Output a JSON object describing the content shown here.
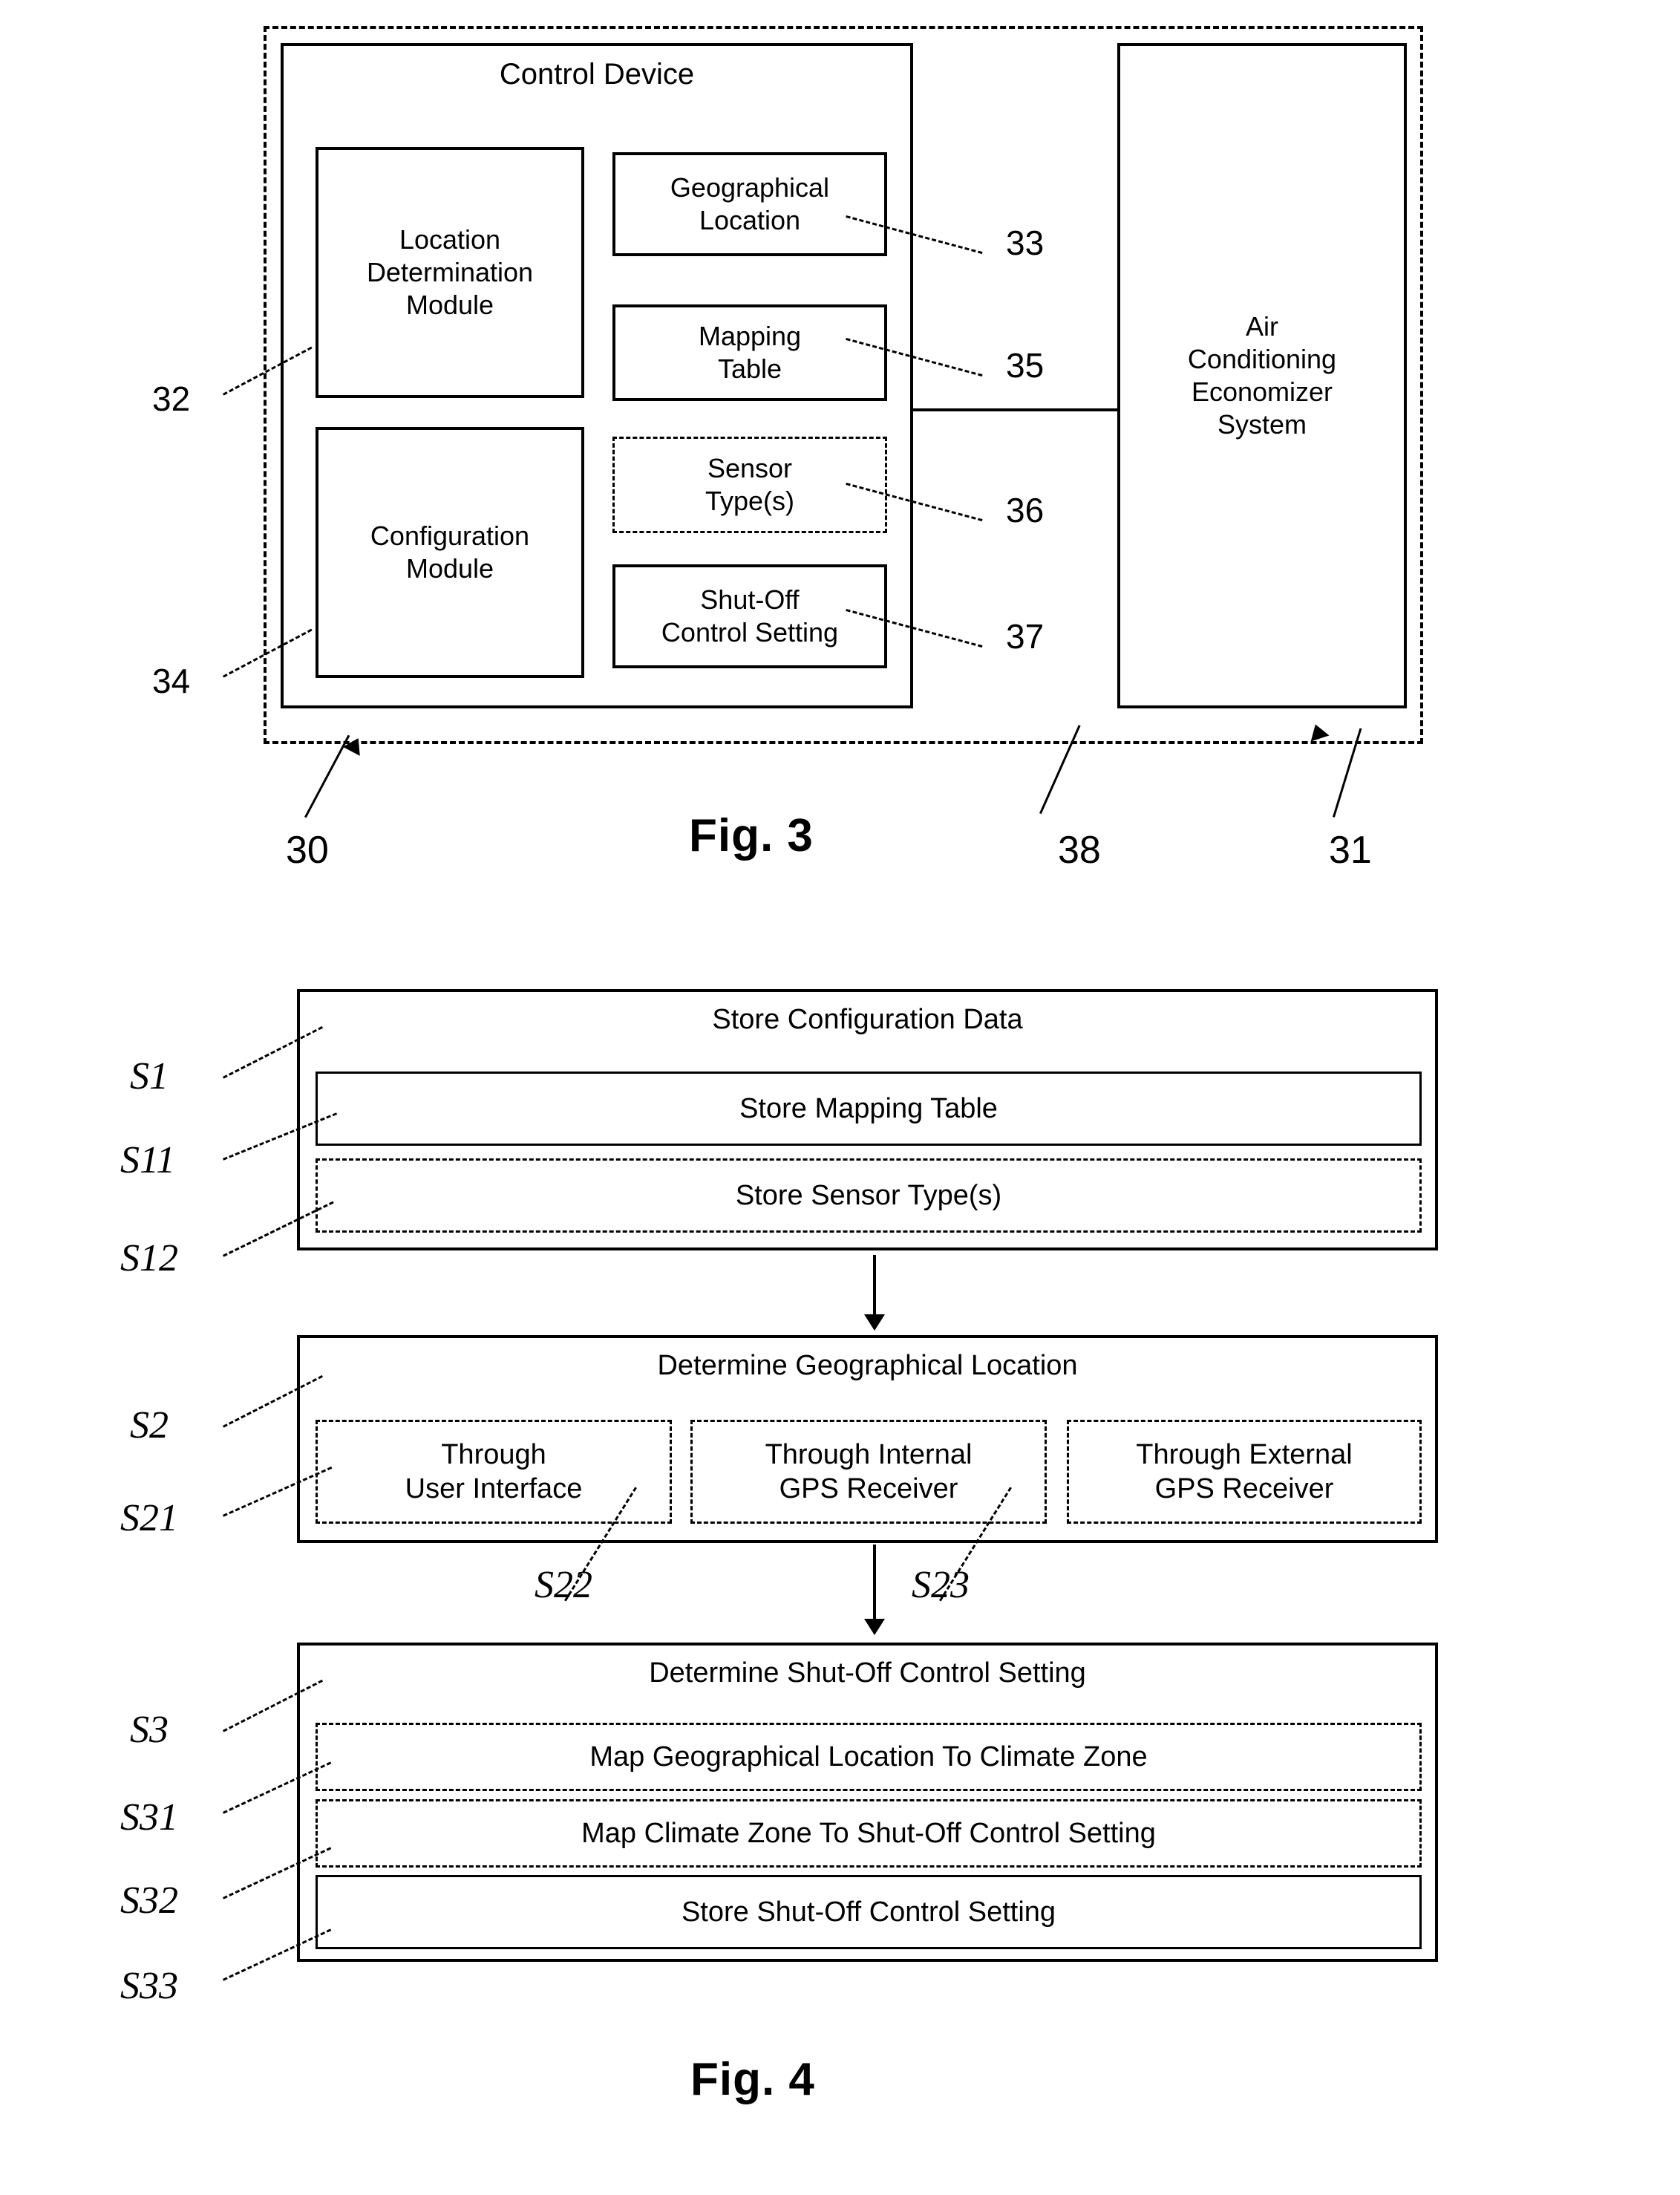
{
  "figure3": {
    "caption": "Fig. 3",
    "outer_ref": "30",
    "system_ref": "38",
    "ac_ref": "31",
    "control_device": {
      "title": "Control Device",
      "location_determination_module": {
        "label": "Location\nDetermination\nModule",
        "ref": "32"
      },
      "configuration_module": {
        "label": "Configuration\nModule",
        "ref": "34"
      },
      "geographical_location": {
        "label": "Geographical\nLocation",
        "ref": "33"
      },
      "mapping_table": {
        "label": "Mapping\nTable",
        "ref": "35"
      },
      "sensor_types": {
        "label": "Sensor\nType(s)",
        "ref": "36"
      },
      "shut_off_control_setting": {
        "label": "Shut-Off\nControl Setting",
        "ref": "37"
      }
    },
    "air_conditioning_economizer_system": {
      "label": "Air\nConditioning\nEconomizer\nSystem"
    }
  },
  "figure4": {
    "caption": "Fig. 4",
    "steps": [
      {
        "id": "S1",
        "label": "Store Configuration Data",
        "substeps": [
          {
            "id": "S11",
            "label": "Store Mapping Table",
            "style": "solid"
          },
          {
            "id": "S12",
            "label": "Store Sensor Type(s)",
            "style": "dashed"
          }
        ]
      },
      {
        "id": "S2",
        "label": "Determine Geographical Location",
        "substeps": [
          {
            "id": "S21",
            "label": "Through\nUser Interface",
            "style": "dashed"
          },
          {
            "id": "S22",
            "label": "Through Internal\nGPS Receiver",
            "style": "dashed"
          },
          {
            "id": "S23",
            "label": "Through External\nGPS Receiver",
            "style": "dashed"
          }
        ]
      },
      {
        "id": "S3",
        "label": "Determine Shut-Off Control Setting",
        "substeps": [
          {
            "id": "S31",
            "label": "Map Geographical Location To Climate Zone",
            "style": "dashed"
          },
          {
            "id": "S32",
            "label": "Map Climate Zone To Shut-Off Control Setting",
            "style": "dashed"
          },
          {
            "id": "S33",
            "label": "Store Shut-Off Control Setting",
            "style": "solid"
          }
        ]
      }
    ]
  },
  "colors": {
    "ink": "#000000",
    "paper": "#ffffff"
  }
}
